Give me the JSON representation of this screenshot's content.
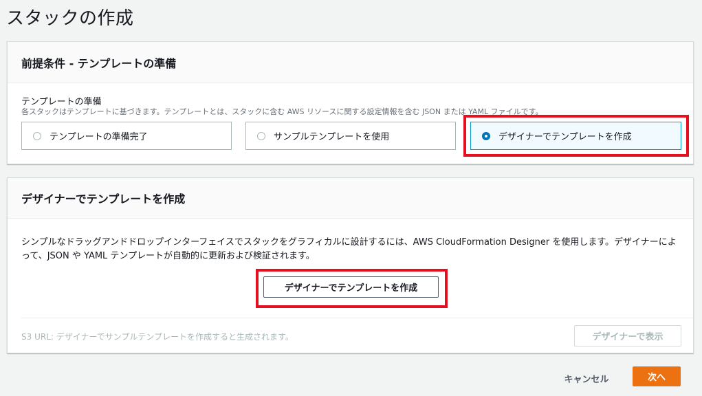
{
  "page": {
    "title": "スタックの作成"
  },
  "prerequisite": {
    "header": "前提条件 - テンプレートの準備",
    "field_label": "テンプレートの準備",
    "field_description": "各スタックはテンプレートに基づきます。テンプレートとは、スタックに含む AWS リソースに関する設定情報を含む JSON または YAML ファイルです。",
    "options": [
      {
        "label": "テンプレートの準備完了",
        "selected": false
      },
      {
        "label": "サンプルテンプレートを使用",
        "selected": false
      },
      {
        "label": "デザイナーでテンプレートを作成",
        "selected": true
      }
    ]
  },
  "designer": {
    "header": "デザイナーでテンプレートを作成",
    "body": "シンプルなドラッグアンドドロップインターフェイスでスタックをグラフィカルに設計するには、AWS CloudFormation Designer を使用します。デザイナーによって、JSON や YAML テンプレートが自動的に更新および検証されます。",
    "create_button": "デザイナーでテンプレートを作成",
    "s3_url_text": "S3 URL: デザイナーでサンプルテンプレートを作成すると生成されます。",
    "view_button": "デザイナーで表示"
  },
  "footer": {
    "cancel_label": "キャンセル",
    "next_label": "次へ"
  },
  "colors": {
    "primary_button": "#ec7211",
    "highlight": "#e3101f",
    "selected_radio": "#0073bb"
  }
}
